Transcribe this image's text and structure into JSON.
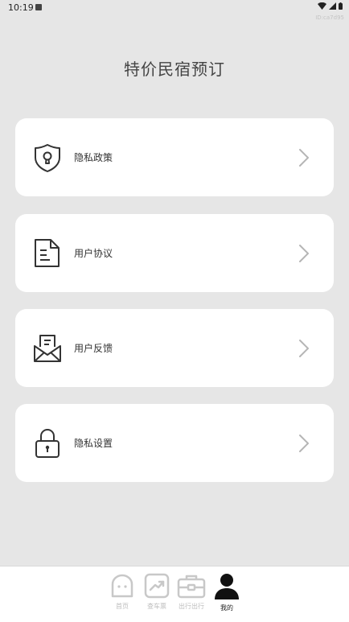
{
  "status": {
    "time": "10:19",
    "id": "ID:ca7d95"
  },
  "header": {
    "title": "特价民宿预订"
  },
  "menu": {
    "items": [
      {
        "label": "隐私政策",
        "icon": "shield-keyhole-icon"
      },
      {
        "label": "用户协议",
        "icon": "document-icon"
      },
      {
        "label": "用户反馈",
        "icon": "mail-feedback-icon"
      },
      {
        "label": "隐私设置",
        "icon": "lock-icon"
      }
    ]
  },
  "tabs": [
    {
      "label": "首页",
      "icon": "home-icon"
    },
    {
      "label": "查车票",
      "icon": "chart-icon"
    },
    {
      "label": "出行出行",
      "icon": "suitcase-icon"
    },
    {
      "label": "我的",
      "icon": "user-icon"
    }
  ]
}
